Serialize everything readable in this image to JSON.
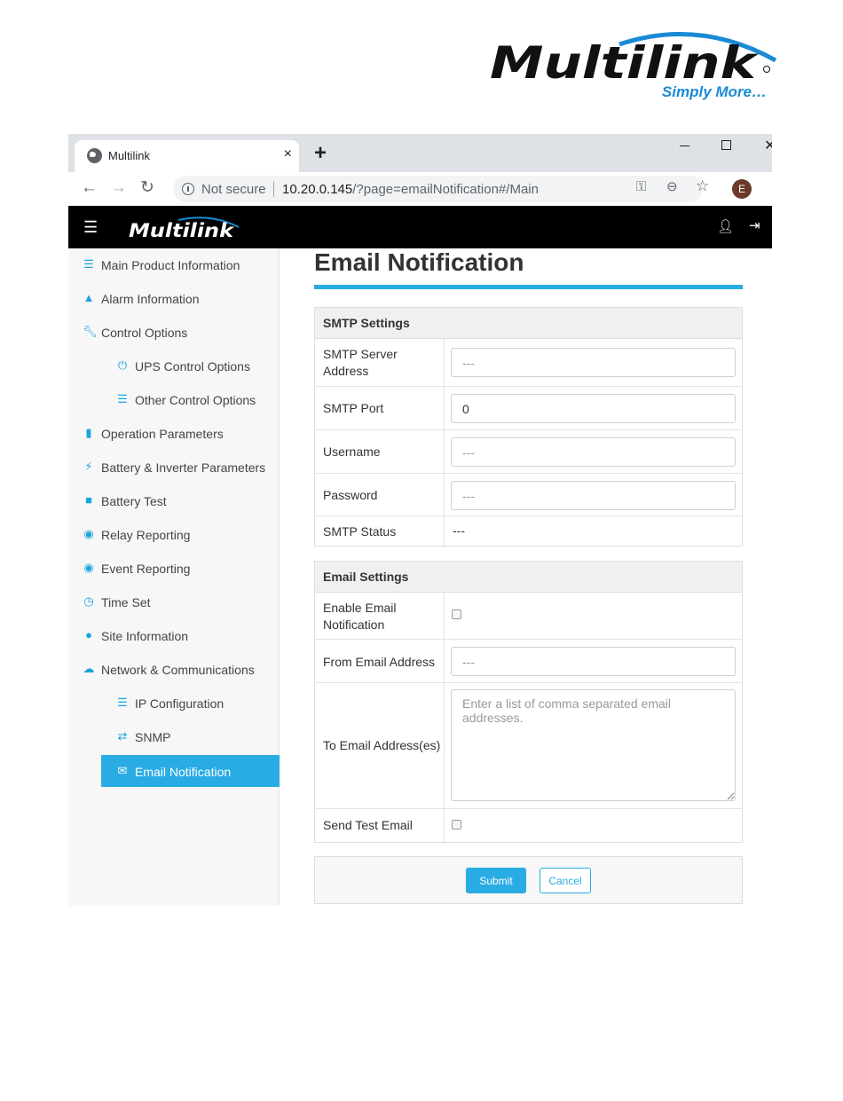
{
  "brand": {
    "name": "Multilink",
    "tagline": "Simply More…",
    "accent": "#29ace3",
    "logo_blue": "#1a8ad4"
  },
  "browser": {
    "tab_title": "Multilink",
    "tab_close": "×",
    "new_tab": "+",
    "security_label": "Not secure",
    "url_host": "10.20.0.145",
    "url_path": "/?page=emailNotification#/Main",
    "profile_initial": "E",
    "icons": [
      "back-icon",
      "forward-icon",
      "reload-icon",
      "key-icon",
      "zoom-icon",
      "star-icon",
      "menu-icon"
    ]
  },
  "navbar": {
    "logo_text": "Multilink",
    "menu_glyph": "☰"
  },
  "sidebar": {
    "items": [
      {
        "label": "Main Product Information",
        "icon": "list-icon",
        "sub": false
      },
      {
        "label": "Alarm Information",
        "icon": "warning-icon",
        "sub": false
      },
      {
        "label": "Control Options",
        "icon": "wrench-icon",
        "sub": false
      },
      {
        "label": "UPS Control Options",
        "icon": "power-icon",
        "sub": true
      },
      {
        "label": "Other Control Options",
        "icon": "list-icon",
        "sub": true
      },
      {
        "label": "Operation Parameters",
        "icon": "bar-chart-icon",
        "sub": false
      },
      {
        "label": "Battery & Inverter Parameters",
        "icon": "bolt-icon",
        "sub": false
      },
      {
        "label": "Battery Test",
        "icon": "battery-icon",
        "sub": false
      },
      {
        "label": "Relay Reporting",
        "icon": "record-icon",
        "sub": false
      },
      {
        "label": "Event Reporting",
        "icon": "record-icon",
        "sub": false
      },
      {
        "label": "Time Set",
        "icon": "clock-icon",
        "sub": false
      },
      {
        "label": "Site Information",
        "icon": "globe-icon",
        "sub": false
      },
      {
        "label": "Network & Communications",
        "icon": "cloud-icon",
        "sub": false
      },
      {
        "label": "IP Configuration",
        "icon": "server-icon",
        "sub": true
      },
      {
        "label": "SNMP",
        "icon": "transfer-icon",
        "sub": true
      },
      {
        "label": "Email Notification",
        "icon": "envelope-icon",
        "sub": true,
        "active": true
      }
    ]
  },
  "main": {
    "title": "Email Notification",
    "smtp": {
      "heading": "SMTP Settings",
      "server_label": "SMTP Server Address",
      "server_placeholder": "---",
      "port_label": "SMTP Port",
      "port_value": "0",
      "username_label": "Username",
      "username_placeholder": "---",
      "password_label": "Password",
      "password_placeholder": "---",
      "status_label": "SMTP Status",
      "status_value": "---"
    },
    "email": {
      "heading": "Email Settings",
      "enable_label": "Enable Email Notification",
      "from_label": "From Email Address",
      "from_placeholder": "---",
      "to_label": "To Email Address(es)",
      "to_placeholder": "Enter a list of comma separated email addresses.",
      "test_label": "Send Test Email"
    },
    "actions": {
      "submit": "Submit",
      "cancel": "Cancel"
    }
  }
}
